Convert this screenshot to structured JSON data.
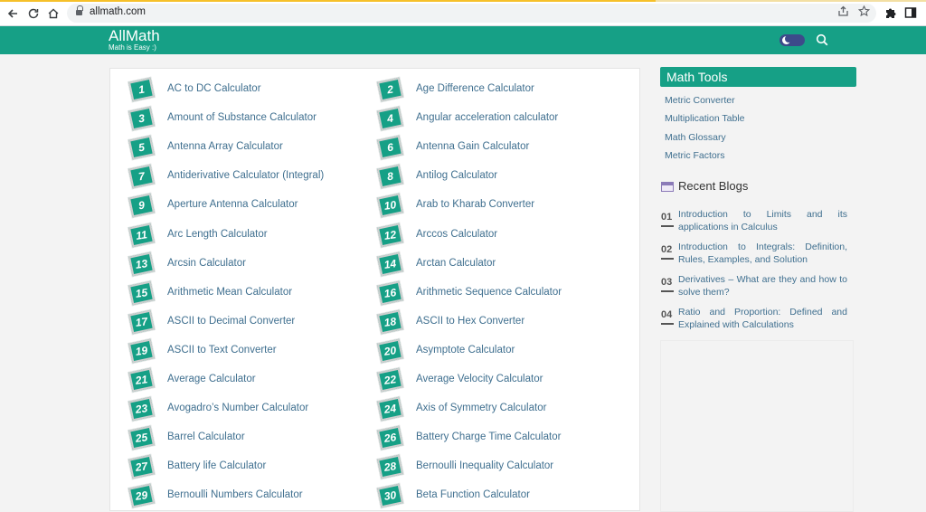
{
  "browser": {
    "url": "allmath.com"
  },
  "site": {
    "brand": "AllMath",
    "tagline": "Math is Easy :)"
  },
  "calculators": [
    {
      "num": "1",
      "label": "AC to DC Calculator"
    },
    {
      "num": "2",
      "label": "Age Difference Calculator"
    },
    {
      "num": "3",
      "label": "Amount of Substance Calculator"
    },
    {
      "num": "4",
      "label": "Angular acceleration calculator"
    },
    {
      "num": "5",
      "label": "Antenna Array Calculator"
    },
    {
      "num": "6",
      "label": "Antenna Gain Calculator"
    },
    {
      "num": "7",
      "label": "Antiderivative Calculator (Integral)"
    },
    {
      "num": "8",
      "label": "Antilog Calculator"
    },
    {
      "num": "9",
      "label": "Aperture Antenna Calculator"
    },
    {
      "num": "10",
      "label": "Arab to Kharab Converter"
    },
    {
      "num": "11",
      "label": "Arc Length Calculator"
    },
    {
      "num": "12",
      "label": "Arccos Calculator"
    },
    {
      "num": "13",
      "label": "Arcsin Calculator"
    },
    {
      "num": "14",
      "label": "Arctan Calculator"
    },
    {
      "num": "15",
      "label": "Arithmetic Mean Calculator"
    },
    {
      "num": "16",
      "label": "Arithmetic Sequence Calculator"
    },
    {
      "num": "17",
      "label": "ASCII to Decimal Converter"
    },
    {
      "num": "18",
      "label": "ASCII to Hex Converter"
    },
    {
      "num": "19",
      "label": "ASCII to Text Converter"
    },
    {
      "num": "20",
      "label": "Asymptote Calculator"
    },
    {
      "num": "21",
      "label": "Average Calculator"
    },
    {
      "num": "22",
      "label": "Average Velocity Calculator"
    },
    {
      "num": "23",
      "label": "Avogadro’s Number Calculator"
    },
    {
      "num": "24",
      "label": "Axis of Symmetry Calculator"
    },
    {
      "num": "25",
      "label": "Barrel Calculator"
    },
    {
      "num": "26",
      "label": "Battery Charge Time Calculator"
    },
    {
      "num": "27",
      "label": "Battery life Calculator"
    },
    {
      "num": "28",
      "label": "Bernoulli Inequality Calculator"
    },
    {
      "num": "29",
      "label": "Bernoulli Numbers Calculator"
    },
    {
      "num": "30",
      "label": "Beta Function Calculator"
    }
  ],
  "sidebar": {
    "tools_title": "Math Tools",
    "tools": [
      "Metric Converter",
      "Multiplication Table",
      "Math Glossary",
      "Metric Factors"
    ],
    "blogs_title": "Recent Blogs",
    "blogs": [
      {
        "num": "01",
        "title": "Introduction to Limits and its applications in Calculus"
      },
      {
        "num": "02",
        "title": "Introduction to Integrals: Definition, Rules, Examples, and Solution"
      },
      {
        "num": "03",
        "title": "Derivatives – What are they and how to solve them?"
      },
      {
        "num": "04",
        "title": "Ratio and Proportion: Defined and Explained with Calculations"
      }
    ]
  },
  "colors": {
    "brand_green": "#16a086",
    "link": "#3f6f8f",
    "toggle": "#3d4a8a"
  }
}
